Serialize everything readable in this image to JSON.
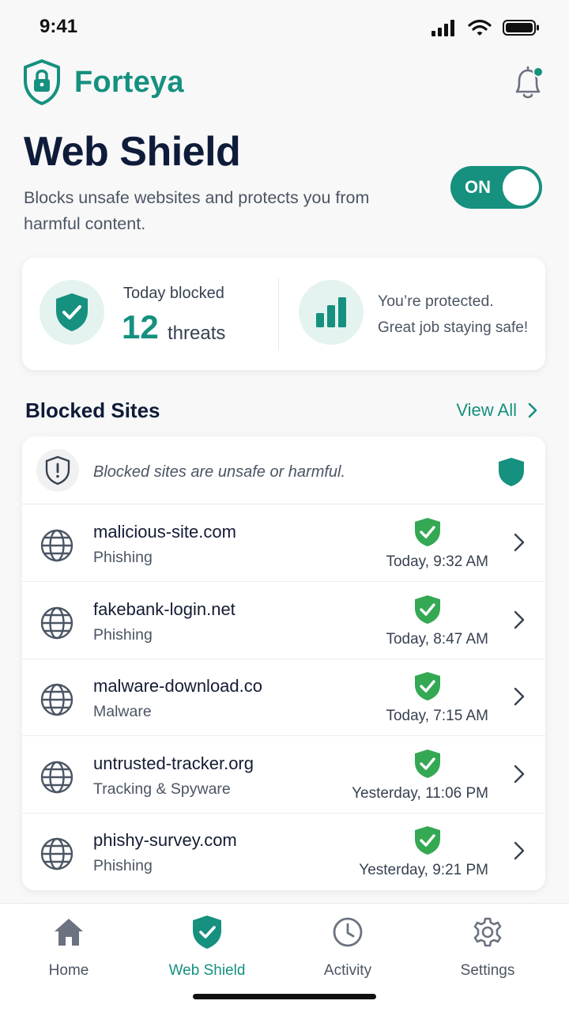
{
  "status_bar": {
    "time": "9:41",
    "icons": [
      "signal-icon",
      "wifi-icon",
      "battery-icon"
    ]
  },
  "app": {
    "name": "Forteya",
    "logo_icon": "shield-lock-icon",
    "notification_icon": "bell-icon",
    "has_notification": true
  },
  "page": {
    "title": "Web Shield",
    "description": "Blocks unsafe websites and protects you from harmful content.",
    "toggle_label": "ON",
    "toggle_on": true
  },
  "stats": {
    "blocked_label": "Today blocked",
    "blocked_count": "12",
    "blocked_unit": "threats",
    "protected_line1": "You’re protected.",
    "protected_line2": "Great job staying safe!"
  },
  "blocked_sites": {
    "title": "Blocked Sites",
    "view_all": "View All",
    "info_text": "Blocked sites are unsafe or harmful.",
    "items": [
      {
        "domain": "malicious-site.com",
        "category": "Phishing",
        "time": "Today, 9:32 AM"
      },
      {
        "domain": "fakebank-login.net",
        "category": "Phishing",
        "time": "Today, 8:47 AM"
      },
      {
        "domain": "malware-download.co",
        "category": "Malware",
        "time": "Today, 7:15 AM"
      },
      {
        "domain": "untrusted-tracker.org",
        "category": "Tracking & Spyware",
        "time": "Yesterday, 11:06 PM"
      },
      {
        "domain": "phishy-survey.com",
        "category": "Phishing",
        "time": "Yesterday, 9:21 PM"
      }
    ]
  },
  "nav": {
    "items": [
      {
        "label": "Home",
        "icon": "home-icon"
      },
      {
        "label": "Web Shield",
        "icon": "shield-check-icon",
        "active": true
      },
      {
        "label": "Activity",
        "icon": "clock-icon"
      },
      {
        "label": "Settings",
        "icon": "gear-icon"
      }
    ]
  },
  "colors": {
    "accent": "#16907f",
    "check_green": "#34a853",
    "title": "#0f1b3a"
  }
}
